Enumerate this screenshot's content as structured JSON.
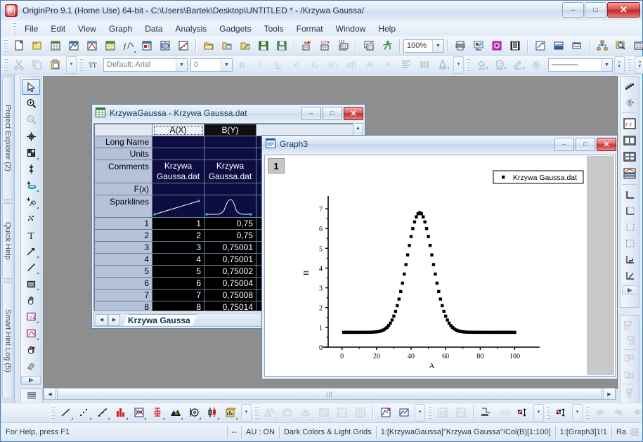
{
  "window": {
    "title": "OriginPro 9.1 (Home Use) 64-bit - C:\\Users\\Bartek\\Desktop\\UNTITLED * - /Krzywa Gaussa/",
    "minimize": "–",
    "maximize": "□",
    "close": "✕"
  },
  "menu": [
    {
      "label": "File"
    },
    {
      "label": "Edit"
    },
    {
      "label": "View"
    },
    {
      "label": "Graph"
    },
    {
      "label": "Data"
    },
    {
      "label": "Analysis"
    },
    {
      "label": "Gadgets"
    },
    {
      "label": "Tools"
    },
    {
      "label": "Format"
    },
    {
      "label": "Window"
    },
    {
      "label": "Help"
    }
  ],
  "toolbar_standard": {
    "zoom_value": "100%",
    "icons": [
      "new-project-icon",
      "new-folder-icon",
      "new-workbook-icon",
      "new-matrix-icon",
      "new-graph-icon",
      "new-excel-icon",
      "new-function-plot-icon",
      "new-layout-icon",
      "new-notes-icon",
      "new-analysis-icon",
      "open-icon",
      "open-excel-icon",
      "open-template-icon",
      "save-project-icon",
      "save-window-icon",
      "import-wizard-icon",
      "import-single-ascii-icon",
      "import-multiple-ascii-icon",
      "duplicate-icon",
      "run-script-icon",
      "print-icon",
      "print-preview-icon",
      "project-explorer-icon",
      "results-log-icon",
      "command-window-icon",
      "script-window-icon",
      "code-builder-icon",
      "layer-management-icon",
      "add-layer-icon",
      "hierarchy-icon",
      "zoom-in-icon",
      "worksheet-icon"
    ]
  },
  "toolbar_format": {
    "font_value": "Default: Arial",
    "size_value": "0",
    "line_value": "————",
    "bold": "B",
    "italic": "I",
    "underline": "U",
    "superscript": "x²",
    "subscript": "x₂",
    "supersub": "x²₁",
    "greek": "αβ",
    "increase_font": "A",
    "decrease_font": "A",
    "icons": [
      "cut-icon",
      "copy-icon",
      "paste-icon",
      "align-icon",
      "columns-icon",
      "font-color-icon",
      "fill-color-icon",
      "pattern-color-icon",
      "line-color-icon",
      "gradient-icon"
    ]
  },
  "left_dock_tabs": [
    {
      "label": "Project Explorer (2)"
    },
    {
      "label": "Quick Help"
    },
    {
      "label": "Smart Hint Log (5)"
    }
  ],
  "left_tools": [
    {
      "name": "pointer-tool",
      "selected": true
    },
    {
      "name": "zoom-in-tool",
      "selected": false
    },
    {
      "name": "zoom-out-tool",
      "selected": false,
      "disabled": true
    },
    {
      "name": "data-reader-tool",
      "selected": false
    },
    {
      "name": "screen-reader-tool",
      "selected": false
    },
    {
      "name": "data-selector-tool",
      "selected": false
    },
    {
      "name": "regional-mask-tool",
      "selected": false
    },
    {
      "name": "regional-data-selector-tool",
      "selected": false
    },
    {
      "name": "scatter-tool",
      "selected": false
    },
    {
      "name": "text-tool",
      "selected": false
    },
    {
      "name": "arrow-tool",
      "selected": false
    },
    {
      "name": "line-tool",
      "selected": false
    },
    {
      "name": "rectangle-tool",
      "selected": false
    },
    {
      "name": "hand-tool",
      "selected": false
    },
    {
      "name": "equation-tool",
      "selected": false
    },
    {
      "name": "region-plot-tool",
      "selected": false
    },
    {
      "name": "scale-tool",
      "selected": false
    },
    {
      "name": "eraser-tool",
      "selected": false
    }
  ],
  "right_tools_top": [
    {
      "name": "pattern-fill-icon"
    },
    {
      "name": "scatter-matrix-icon"
    },
    {
      "name": "merge-layers-icon"
    },
    {
      "name": "four-panel-layout-icon"
    },
    {
      "name": "stack-layers-icon"
    },
    {
      "name": "extract-layers-icon"
    },
    {
      "name": "axis-bottom-left-icon"
    },
    {
      "name": "axis-dashed-top-icon"
    },
    {
      "name": "axis-dashed-right-icon"
    },
    {
      "name": "axis-frame-icon"
    },
    {
      "name": "axis-ticks-icon"
    },
    {
      "name": "axis-add-icon"
    }
  ],
  "right_tools_bottom": [
    {
      "name": "align-left-objects-icon"
    },
    {
      "name": "align-right-objects-icon"
    },
    {
      "name": "align-top-objects-icon"
    },
    {
      "name": "align-bottom-objects-icon"
    },
    {
      "name": "center-horizontal-icon"
    },
    {
      "name": "center-vertical-icon"
    }
  ],
  "worksheet_window": {
    "title": "KrzywaGaussa - Krzywa Gaussa.dat",
    "icon": "worksheet-window-icon",
    "minimize": "–",
    "maximize": "□",
    "close": "✕",
    "sheet_tab": "Krzywa Gaussa",
    "column_headers": [
      "",
      "A(X)",
      "B(Y)"
    ],
    "meta_rows": [
      {
        "label": "Long Name",
        "a": "",
        "b": ""
      },
      {
        "label": "Units",
        "a": "",
        "b": ""
      },
      {
        "label": "Comments",
        "a": "Krzywa Gaussa.dat",
        "b": "Krzywa Gaussa.dat"
      },
      {
        "label": "F(x)",
        "a": "",
        "b": ""
      },
      {
        "label": "Sparklines",
        "a": "sparkline-line",
        "b": "sparkline-gaussian"
      }
    ],
    "rows": [
      {
        "n": "1",
        "a": "1",
        "b": "0,75"
      },
      {
        "n": "2",
        "a": "2",
        "b": "0,75"
      },
      {
        "n": "3",
        "a": "3",
        "b": "0,75001"
      },
      {
        "n": "4",
        "a": "4",
        "b": "0,75001"
      },
      {
        "n": "5",
        "a": "5",
        "b": "0,75002"
      },
      {
        "n": "6",
        "a": "6",
        "b": "0,75004"
      },
      {
        "n": "7",
        "a": "7",
        "b": "0,75008"
      },
      {
        "n": "8",
        "a": "8",
        "b": "0,75014"
      }
    ]
  },
  "graph_window": {
    "title": "Graph3",
    "icon": "graph-window-icon",
    "layer_badge": "1",
    "minimize": "–",
    "maximize": "□",
    "close": "✕"
  },
  "chart_data": {
    "type": "scatter",
    "title": "",
    "xlabel": "A",
    "ylabel": "B",
    "xlim": [
      -8,
      112
    ],
    "ylim": [
      0,
      7.5
    ],
    "xticks": [
      0,
      20,
      40,
      60,
      80,
      100
    ],
    "yticks": [
      0,
      1,
      2,
      3,
      4,
      5,
      6,
      7
    ],
    "grid": false,
    "legend": {
      "position": "top-right",
      "entries": [
        {
          "label": "Krzywa Gaussa.dat",
          "marker": "square",
          "color": "#000000"
        }
      ]
    },
    "series": [
      {
        "name": "Krzywa Gaussa.dat",
        "marker": "square",
        "color": "#000000",
        "model": "gaussian",
        "baseline": 0.75,
        "amplitude": 6.05,
        "center": 45,
        "sigma": 7.5,
        "x_start": 1,
        "x_end": 100,
        "x_step": 1
      }
    ]
  },
  "bottom_toolbars": {
    "left_icons": [
      "line-plot-icon",
      "scatter-plot-icon",
      "line-symbol-icon",
      "column-plot-icon",
      "area-plot-icon",
      "error-bar-icon",
      "fill-area-icon",
      "polar-plot-icon",
      "box-chart-icon",
      "3d-bar-icon"
    ],
    "right_icons": [
      "contour-icon",
      "image-plot-icon",
      "wire-surface-icon",
      "color-map-surface-icon",
      "ternary-icon",
      "matrix-icon",
      "bar-3d-icon",
      "ribbon-icon",
      "waterfall-icon",
      "pie-3d-icon",
      "symbol-icon",
      "vector-icon",
      "cone-icon",
      "pyramid-icon",
      "prism-icon"
    ]
  },
  "status_bar": {
    "help_text": "For Help, press F1",
    "sep": "--",
    "au": "AU : ON",
    "theme": "Dark Colors & Light Grids",
    "selection": "1:[KrzywaGaussa]\"Krzywa Gaussa\"!Col(B)[1:100]",
    "graph_ref": "1:[Graph3]1!1",
    "ra": "Ra"
  }
}
